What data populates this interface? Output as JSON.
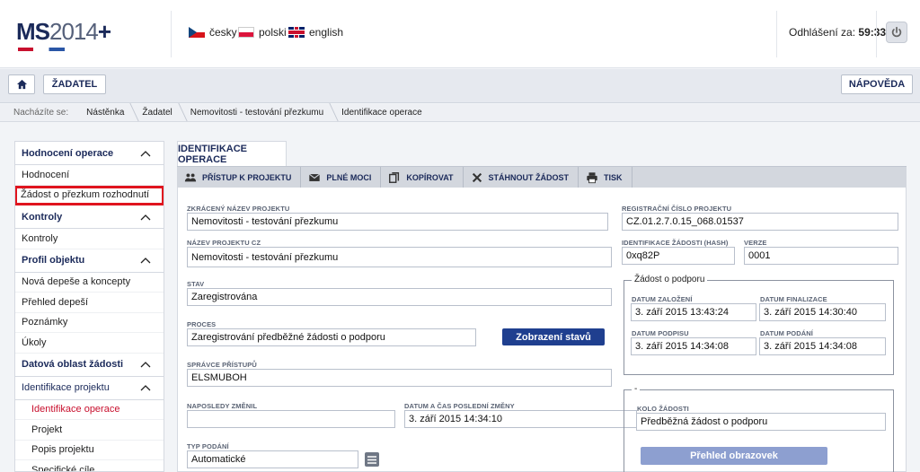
{
  "header": {
    "logo_bold": "MS",
    "logo_thin": "2014",
    "logo_plus": "+",
    "languages": [
      {
        "label": "česky",
        "flag": "cz"
      },
      {
        "label": "polski",
        "flag": "pl"
      },
      {
        "label": "english",
        "flag": "gb"
      }
    ],
    "logout_label": "Odhlášení za:",
    "logout_timer": "59:33",
    "power_icon": "power-icon"
  },
  "nav": {
    "home_icon": "home-icon",
    "applicant_label": "ŽADATEL",
    "help_label": "NÁPOVĚDA"
  },
  "breadcrumb": {
    "lead": "Nacházíte se:",
    "items": [
      "Nástěnka",
      "Žadatel",
      "Nemovitosti - testování přezkumu",
      "Identifikace operace"
    ]
  },
  "sidebar": {
    "sections": [
      {
        "title": "Hodnocení operace",
        "items": [
          {
            "label": "Hodnocení"
          },
          {
            "label": "Žádost o přezkum rozhodnutí",
            "highlight": true
          }
        ]
      },
      {
        "title": "Kontroly",
        "items": [
          {
            "label": "Kontroly"
          }
        ]
      },
      {
        "title": "Profil objektu",
        "items": [
          {
            "label": "Nová depeše a koncepty"
          },
          {
            "label": "Přehled depeší"
          },
          {
            "label": "Poznámky"
          },
          {
            "label": "Úkoly"
          }
        ]
      },
      {
        "title": "Datová oblast žádosti",
        "items": []
      },
      {
        "title": "Identifikace projektu",
        "items": [
          {
            "label": "Identifikace operace",
            "active": true
          },
          {
            "label": "Projekt"
          },
          {
            "label": "Popis projektu"
          },
          {
            "label": "Specifické cíle"
          }
        ]
      }
    ]
  },
  "main": {
    "tab_label": "IDENTIFIKACE OPERACE",
    "toolbar": [
      {
        "label": "PŘÍSTUP K PROJEKTU",
        "icon": "people-icon"
      },
      {
        "label": "PLNÉ MOCI",
        "icon": "envelope-icon"
      },
      {
        "label": "KOPÍROVAT",
        "icon": "copy-icon"
      },
      {
        "label": "STÁHNOUT ŽÁDOST",
        "icon": "close-icon"
      },
      {
        "label": "TISK",
        "icon": "printer-icon"
      }
    ],
    "form": {
      "short_name_label": "ZKRÁCENÝ NÁZEV PROJEKTU",
      "short_name_value": "Nemovitosti - testování přezkumu",
      "reg_number_label": "REGISTRAČNÍ ČÍSLO PROJEKTU",
      "reg_number_value": "CZ.01.2.7.0.15_068.01537",
      "name_cz_label": "NÁZEV PROJEKTU CZ",
      "name_cz_value": "Nemovitosti - testování přezkumu",
      "hash_label": "IDENTIFIKACE ŽÁDOSTI (HASH)",
      "hash_value": "0xq82P",
      "version_label": "VERZE",
      "version_value": "0001",
      "state_label": "STAV",
      "state_value": "Zaregistrována",
      "process_label": "PROCES",
      "process_value": "Zaregistrování předběžné žádosti o podporu",
      "states_button": "Zobrazení stavů",
      "access_admin_label": "SPRÁVCE PŘÍSTUPŮ",
      "access_admin_value": "ELSMUBOH",
      "last_changed_label": "NAPOSLEDY ZMĚNIL",
      "last_changed_value": "",
      "last_change_date_label": "DATUM A ČAS POSLEDNÍ ZMĚNY",
      "last_change_date_value": "3. září 2015 14:34:10",
      "submission_type_label": "TYP PODÁNÍ",
      "submission_type_value": "Automatické"
    },
    "support_box": {
      "legend": "Žádost o podporu",
      "created_label": "DATUM ZALOŽENÍ",
      "created_value": "3. září 2015 13:43:24",
      "finalized_label": "DATUM FINALIZACE",
      "finalized_value": "3. září 2015 14:30:40",
      "signed_label": "DATUM PODPISU",
      "signed_value": "3. září 2015 14:34:08",
      "submitted_label": "DATUM PODÁNÍ",
      "submitted_value": "3. září 2015 14:34:08"
    },
    "round_box": {
      "legend": "-",
      "round_label": "KOLO ŽÁDOSTI",
      "round_value": "Předběžná žádost o podporu",
      "screens_button": "Přehled obrazovek"
    }
  }
}
